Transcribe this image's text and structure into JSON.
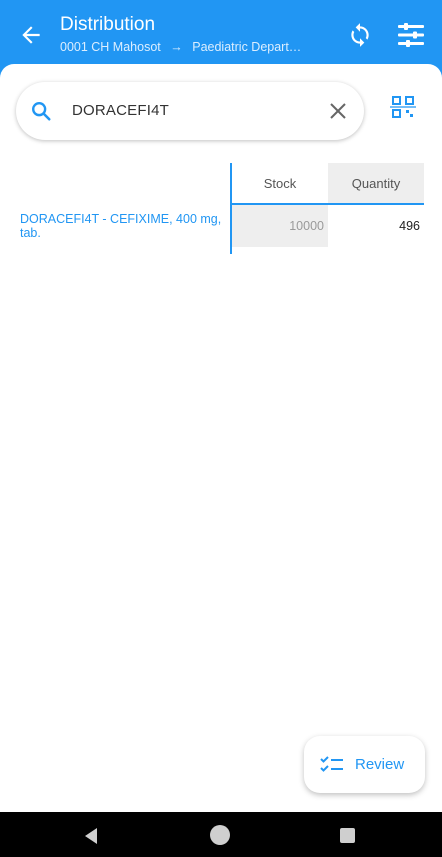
{
  "header": {
    "title": "Distribution",
    "subtitle_from": "0001 CH Mahosot",
    "subtitle_arrow": "→",
    "subtitle_to": "Paediatric Depart…"
  },
  "search": {
    "value": "DORACEFI4T"
  },
  "table": {
    "columns": [
      "Stock",
      "Quantity"
    ],
    "rows": [
      {
        "name": "DORACEFI4T - CEFIXIME, 400 mg, tab.",
        "stock": "10000",
        "quantity": "496"
      }
    ]
  },
  "review_button": {
    "label": "Review"
  },
  "colors": {
    "primary": "#2196F3",
    "cell_bg": "#eeeeee"
  },
  "icons": [
    "back-arrow-icon",
    "sync-icon",
    "filter-icon",
    "search-icon",
    "close-icon",
    "qr-scan-icon",
    "checklist-icon"
  ]
}
